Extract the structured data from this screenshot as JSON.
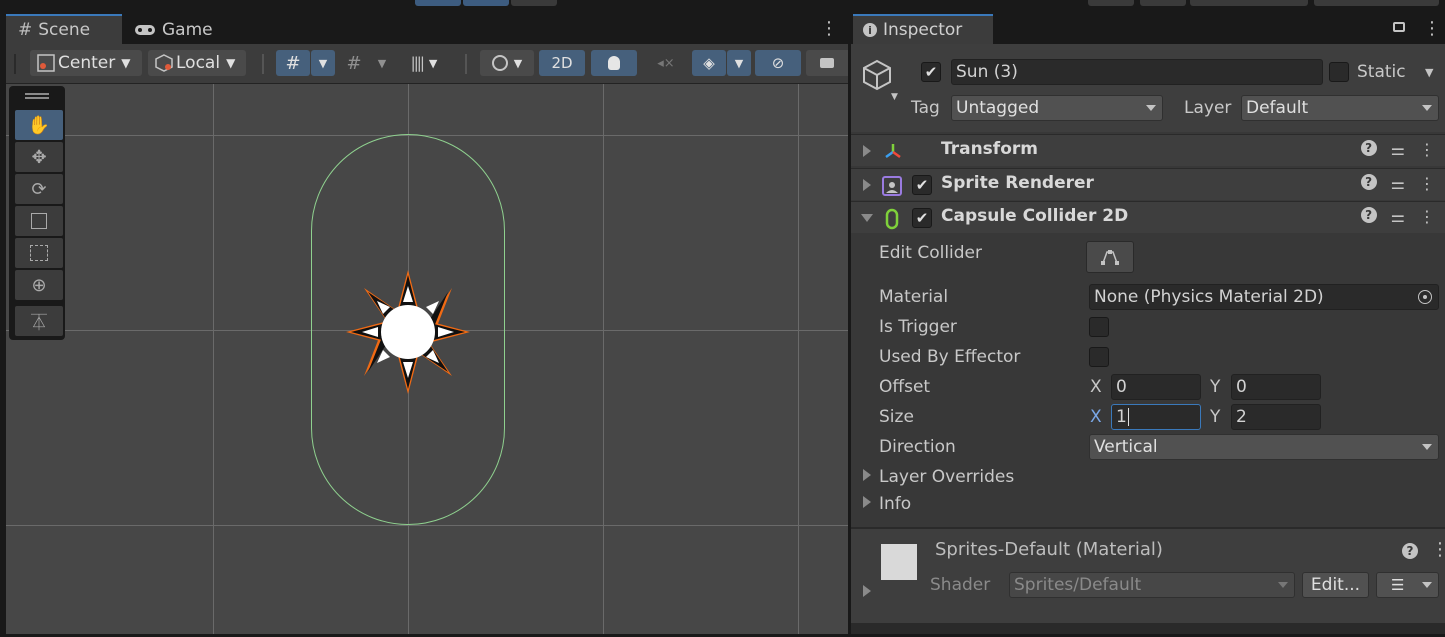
{
  "scene_panel": {
    "tabs": [
      {
        "label": "Scene"
      },
      {
        "label": "Game"
      }
    ],
    "toolbar": {
      "pivot_mode": "Center",
      "pivot_rotation": "Local",
      "toggle_2d": "2D"
    }
  },
  "inspector": {
    "tab_label": "Inspector",
    "object": {
      "name": "Sun (3)",
      "static_label": "Static",
      "tag_label": "Tag",
      "tag_value": "Untagged",
      "layer_label": "Layer",
      "layer_value": "Default"
    },
    "components": [
      {
        "title": "Transform"
      },
      {
        "title": "Sprite Renderer"
      },
      {
        "title": "Capsule Collider 2D"
      }
    ],
    "collider": {
      "edit_collider_label": "Edit Collider",
      "material_label": "Material",
      "material_value": "None (Physics Material 2D)",
      "is_trigger_label": "Is Trigger",
      "used_by_effector_label": "Used By Effector",
      "offset_label": "Offset",
      "offset_x": "0",
      "offset_y": "0",
      "size_label": "Size",
      "size_x": "1",
      "size_y": "2",
      "direction_label": "Direction",
      "direction_value": "Vertical",
      "layer_overrides_label": "Layer Overrides",
      "info_label": "Info",
      "x_label": "X",
      "y_label": "Y"
    },
    "material_block": {
      "name": "Sprites-Default (Material)",
      "shader_label": "Shader",
      "shader_value": "Sprites/Default",
      "edit_button": "Edit..."
    }
  }
}
